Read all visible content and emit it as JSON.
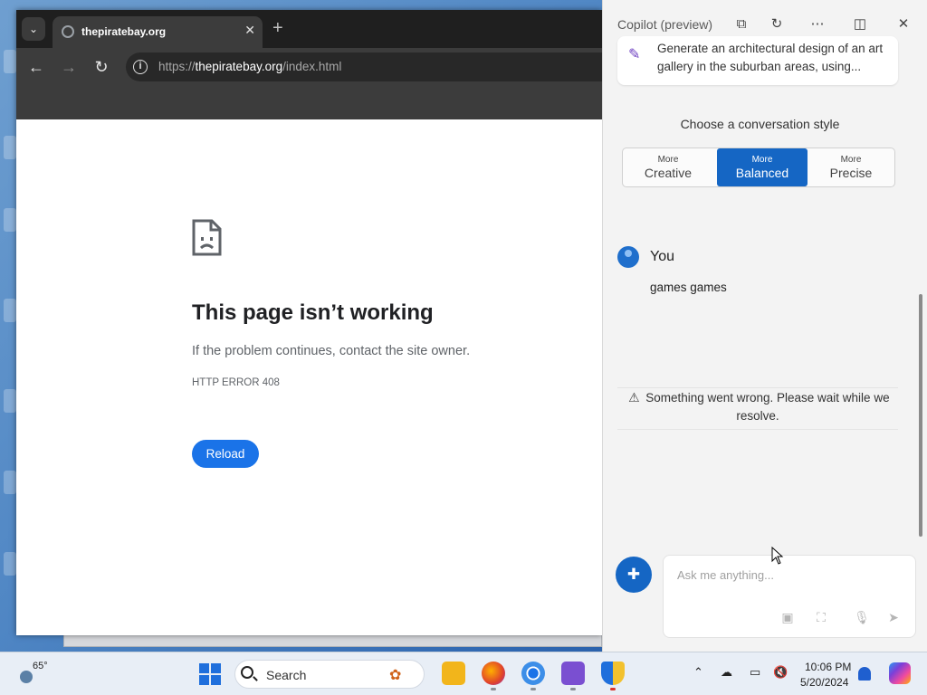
{
  "browser": {
    "tab_title": "thepiratebay.org",
    "url_scheme": "https://",
    "url_host": "thepiratebay.org",
    "url_path": "/index.html"
  },
  "error_page": {
    "heading": "This page isn’t working",
    "description": "If the problem continues, contact the site owner.",
    "code": "HTTP ERROR 408",
    "reload_label": "Reload"
  },
  "copilot": {
    "title": "Copilot (preview)",
    "suggestion_text": "Generate an architectural design of an art gallery in the suburban areas, using...",
    "style_heading": "Choose a conversation style",
    "styles": [
      {
        "small": "More",
        "big": "Creative"
      },
      {
        "small": "More",
        "big": "Balanced"
      },
      {
        "small": "More",
        "big": "Precise"
      }
    ],
    "active_style": "Balanced",
    "user_label": "You",
    "user_message": "games games",
    "error_message": "Something went wrong. Please wait while we resolve.",
    "input_placeholder": "Ask me anything..."
  },
  "taskbar": {
    "weather_temp": "65°",
    "search_label": "Search",
    "time": "10:06 PM",
    "date": "5/20/2024"
  },
  "colors": {
    "accent": "#1566c4",
    "reload_button": "#1a73e8",
    "browser_chrome": "#3c3c3c"
  }
}
